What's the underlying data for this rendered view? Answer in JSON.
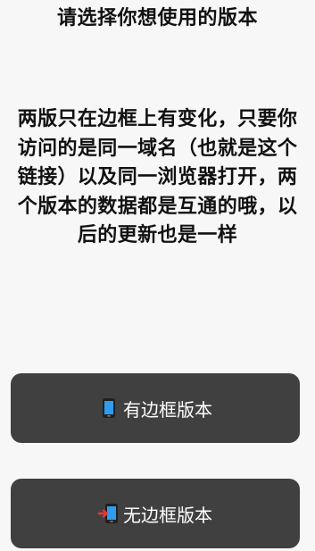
{
  "header": {
    "title": "请选择你想使用的版本"
  },
  "main": {
    "description": "两版只在边框上有变化，只要你访问的是同一域名（也就是这个链接）以及同一浏览器打开，两个版本的数据都是互通的哦，以后的更新也是一样",
    "buttons": [
      {
        "label": "有边框版本",
        "icon": "mobile-phone-icon"
      },
      {
        "label": "无边框版本",
        "icon": "mobile-phone-with-arrow-icon"
      }
    ]
  },
  "colors": {
    "background": "#f7f7f7",
    "button_background": "#404040",
    "button_text": "#ffffff",
    "text": "#111111",
    "icon_accent": "#2f9cf0"
  }
}
